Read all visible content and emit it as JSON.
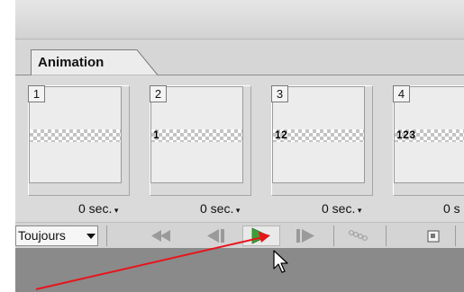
{
  "panel": {
    "tab_label": "Animation"
  },
  "frames": [
    {
      "number": "1",
      "thumb_text": "",
      "delay": "0 sec."
    },
    {
      "number": "2",
      "thumb_text": "1",
      "delay": "0 sec."
    },
    {
      "number": "3",
      "thumb_text": "12",
      "delay": "0 sec."
    },
    {
      "number": "4",
      "thumb_text": "123",
      "delay": "0 s"
    }
  ],
  "toolbar": {
    "loop_option": "Toujours"
  },
  "colors": {
    "panel_bg": "#d9d9d9",
    "play_icon": "#3aa037",
    "annotation_arrow": "#e8141b"
  },
  "icons": {
    "first_frame": "rewind-icon",
    "prev_frame": "step-back-icon",
    "play": "play-icon",
    "next_frame": "step-forward-icon",
    "tween": "tween-icon",
    "duplicate": "duplicate-frame-icon",
    "dropdown": "chevron-down-icon",
    "pointer": "mouse-cursor-icon"
  }
}
